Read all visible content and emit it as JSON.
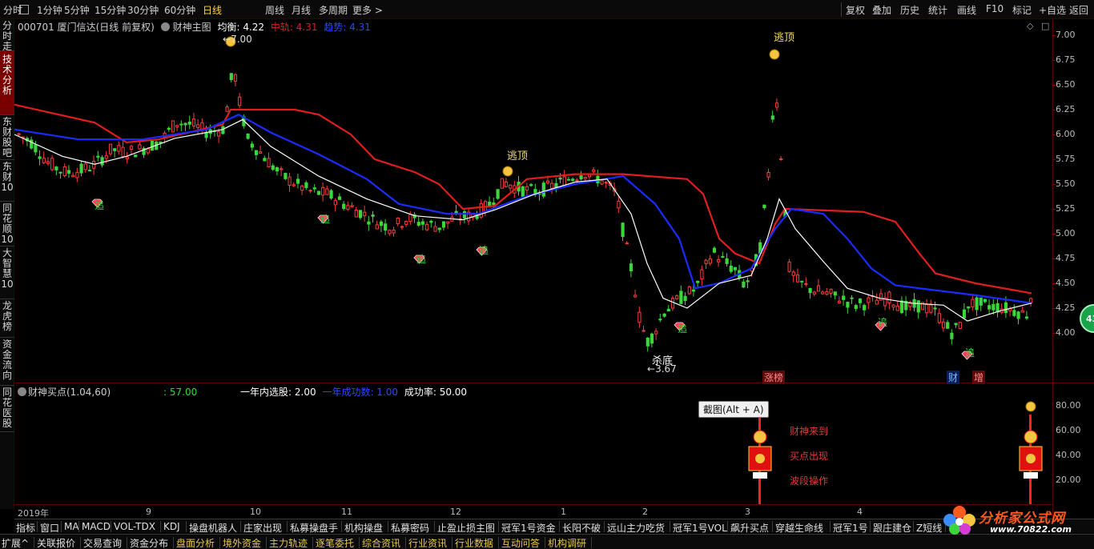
{
  "topbar": {
    "items": [
      "分时",
      "1分钟",
      "5分钟",
      "15分钟",
      "30分钟",
      "60分钟",
      "日线",
      "周线",
      "月线",
      "多周期",
      "更多"
    ],
    "more_arrow": ">",
    "right_items": [
      "复权",
      "叠加",
      "历史",
      "统计",
      "画线",
      "F10",
      "标记",
      "+自选",
      "返回"
    ]
  },
  "sidebar": {
    "tabs": [
      "分时走势",
      "技术分析",
      "东财股吧",
      "东财10",
      "同花顺10",
      "大智慧10",
      "龙虎榜",
      "资金流向",
      "同花医股"
    ]
  },
  "stock": {
    "code_name": "000701 厦门信达(日线 前复权)",
    "indicator": "财神主图",
    "avg_label": "均衡: 4.22",
    "mid_label": "中轨: 4.31",
    "trend_label": "趋势: 4.31",
    "diamond": "◇",
    "box": "□"
  },
  "colors": {
    "up": "#ff3b3b",
    "down": "#3bd63b",
    "mid_track": "#e01e1e",
    "trend": "#1a2cff",
    "avg": "#ffffff",
    "gold": "#f5c542"
  },
  "main_chart": {
    "yaxis": [
      "7.00",
      "6.75",
      "6.50",
      "6.25",
      "6.00",
      "5.75",
      "5.50",
      "5.25",
      "5.00",
      "4.75",
      "4.50",
      "4.25",
      "4.00"
    ],
    "high_label": "7.00",
    "low_label": "3.67",
    "annotations": {
      "escape_top": "逃顶",
      "kill_bottom": "杀底",
      "chase": "追",
      "zhangbang": "涨榜",
      "cai": "财",
      "zeng": "增"
    }
  },
  "sub_chart": {
    "name": "财神买点(1.04,60)",
    "value": ": 57.00",
    "year_select": "一年内选股: 2.00",
    "year_success": "一年成功数: 1.00",
    "success_rate": "成功率: 50.00",
    "yaxis": [
      "80.00",
      "60.00",
      "40.00",
      "20.00"
    ],
    "signals": [
      "财神来到",
      "买点出现",
      "波段操作"
    ]
  },
  "xaxis": [
    "2019年",
    "9",
    "10",
    "11",
    "12",
    "1",
    "2",
    "3",
    "4"
  ],
  "tooltip": "截图(Alt + A)",
  "badge": "43",
  "indicator_tabs": [
    "指标",
    "窗口",
    "MA",
    "MACD",
    "VOL-TDX",
    "KDJ",
    "操盘机器人",
    "庄家出现",
    "私募操盘手",
    "机构操盘",
    "私募密码",
    "止盈止损主图",
    "冠军1号资金",
    "长阳不破",
    "远山主力吃货",
    "冠军1号VOL",
    "飙升买点",
    "穿越生命线",
    "冠军1号",
    "跟庄建仓",
    "Z短线"
  ],
  "bottom_tabs": [
    "扩展^",
    "关联报价",
    "交易查询",
    "资金分布",
    "盘面分析",
    "境外资金",
    "主力轨迹",
    "逐笔委托",
    "综合资讯",
    "行业资讯",
    "行业数据",
    "互动问答",
    "机构调研"
  ],
  "logo": {
    "title": "分析家公式网",
    "url": "www.70822.com"
  }
}
